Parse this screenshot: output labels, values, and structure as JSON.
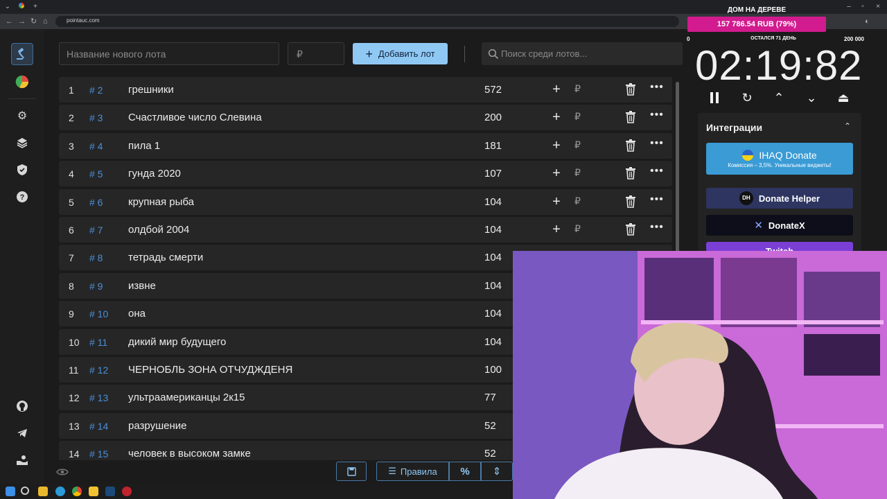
{
  "browser": {
    "url": "pointauc.com"
  },
  "toolbar": {
    "lot_name_placeholder": "Название нового лота",
    "price_placeholder": "₽",
    "add_button_label": "Добавить лот",
    "search_placeholder": "Поиск среди лотов..."
  },
  "lots": [
    {
      "num": "1",
      "id": "# 2",
      "name": "грешники",
      "amount": "572"
    },
    {
      "num": "2",
      "id": "# 3",
      "name": "Счастливое число Слевина",
      "amount": "200"
    },
    {
      "num": "3",
      "id": "# 4",
      "name": "пила 1",
      "amount": "181"
    },
    {
      "num": "4",
      "id": "# 5",
      "name": "гунда 2020",
      "amount": "107"
    },
    {
      "num": "5",
      "id": "# 6",
      "name": "крупная рыба",
      "amount": "104"
    },
    {
      "num": "6",
      "id": "# 7",
      "name": "олдбой 2004",
      "amount": "104"
    },
    {
      "num": "7",
      "id": "# 8",
      "name": "тетрадь смерти",
      "amount": "104"
    },
    {
      "num": "8",
      "id": "# 9",
      "name": "извне",
      "amount": "104"
    },
    {
      "num": "9",
      "id": "# 10",
      "name": "она",
      "amount": "104"
    },
    {
      "num": "10",
      "id": "# 11",
      "name": "дикий мир будущего",
      "amount": "104"
    },
    {
      "num": "11",
      "id": "# 12",
      "name": "ЧЕРНОБЛЬ ЗОНА ОТЧУДЖДЕНЯ",
      "amount": "100"
    },
    {
      "num": "12",
      "id": "# 13",
      "name": "ультраамериканцы 2к15",
      "amount": "77"
    },
    {
      "num": "13",
      "id": "# 14",
      "name": "разрушение",
      "amount": "52"
    },
    {
      "num": "14",
      "id": "# 15",
      "name": "человек в высоком замке",
      "amount": "52"
    }
  ],
  "row_actions": {
    "plus": "+",
    "rub": "₽",
    "more": "•••"
  },
  "bottom_bar": {
    "rules_label": "Правила",
    "percent_label": "%"
  },
  "timer": {
    "title": "ДОМ НА ДЕРЕВЕ",
    "bar_text": "157 786.54 RUB (79%)",
    "progress_fraction": 0.79,
    "range_min": "0",
    "range_label": "ОСТАЛСЯ 71 ДЕНЬ",
    "range_max": "200 000",
    "time": "02:19:82"
  },
  "integrations": {
    "title": "Интеграции",
    "items": [
      {
        "label": "IHAQ Donate",
        "sub": "Комиссия – 3,5%. Уникальные виджеты!",
        "color": "#3a9bd5"
      },
      {
        "label": "Donate Helper",
        "color": "#2d3560"
      },
      {
        "label": "DonateX",
        "color": "#0e0e1a"
      },
      {
        "label": "Twitch",
        "color": "#7b3fd6"
      }
    ]
  },
  "colors": {
    "accent": "#90c8f4",
    "id_blue": "#4a90d9",
    "timer_bar": "#d11b8e"
  },
  "icons": {
    "sidebar": [
      "auction-hammer-icon",
      "pie-chart-icon",
      "gear-icon",
      "layers-icon",
      "shield-check-icon",
      "help-icon",
      "github-icon",
      "telegram-icon",
      "donate-hand-icon"
    ]
  }
}
